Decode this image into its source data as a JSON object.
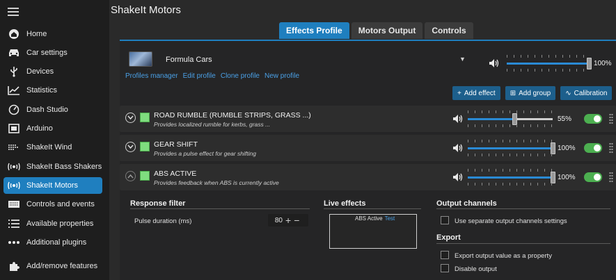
{
  "app": {
    "title": "ShakeIt Motors"
  },
  "sidebar": {
    "items": [
      {
        "label": "Home",
        "icon": "home-icon"
      },
      {
        "label": "Car settings",
        "icon": "car-icon"
      },
      {
        "label": "Devices",
        "icon": "usb-icon"
      },
      {
        "label": "Statistics",
        "icon": "chart-icon"
      },
      {
        "label": "Dash Studio",
        "icon": "gauge-icon"
      },
      {
        "label": "Arduino",
        "icon": "arduino-icon"
      },
      {
        "label": "ShakeIt Wind",
        "icon": "wind-icon"
      },
      {
        "label": "ShakeIt Bass Shakers",
        "icon": "vibration-icon"
      },
      {
        "label": "ShakeIt Motors",
        "icon": "vibration-icon",
        "active": true
      },
      {
        "label": "Controls and events",
        "icon": "keyboard-icon"
      },
      {
        "label": "Available properties",
        "icon": "list-icon"
      },
      {
        "label": "Additional plugins",
        "icon": "dots-icon"
      },
      {
        "label": "Add/remove features",
        "icon": "puzzle-icon"
      }
    ]
  },
  "tabs": [
    {
      "label": "Effects Profile",
      "active": true
    },
    {
      "label": "Motors Output"
    },
    {
      "label": "Controls"
    }
  ],
  "profile": {
    "name": "Formula Cars",
    "links": [
      "Profiles manager",
      "Edit profile",
      "Clone profile",
      "New profile"
    ],
    "master_volume": 100,
    "master_volume_label": "100%"
  },
  "buttons": {
    "add_effect": "Add effect",
    "add_group": "Add group",
    "calibration": "Calibration"
  },
  "effects": [
    {
      "name": "ROAD RUMBLE (RUMBLE STRIPS, GRASS ...)",
      "description": "Provides localized rumble for kerbs, grass ...",
      "volume": 55,
      "volume_label": "55%",
      "enabled": true,
      "expanded": false
    },
    {
      "name": "GEAR SHIFT",
      "description": "Provides a pulse effect for gear shifting",
      "volume": 100,
      "volume_label": "100%",
      "enabled": true,
      "expanded": false
    },
    {
      "name": "ABS ACTIVE",
      "description": "Provides feedback when ABS is currently active",
      "volume": 100,
      "volume_label": "100%",
      "enabled": true,
      "expanded": true
    }
  ],
  "details": {
    "response_filter": {
      "title": "Response filter",
      "pulse_label": "Pulse duration (ms)",
      "pulse_value": "80"
    },
    "live_effects": {
      "title": "Live effects",
      "label": "ABS Active",
      "test": "Test"
    },
    "output_channels": {
      "title": "Output channels",
      "separate_label": "Use separate output channels settings"
    },
    "export": {
      "title": "Export",
      "export_property_label": "Export output value as a property",
      "disable_output_label": "Disable output"
    }
  },
  "colors": {
    "accent": "#1f7fbf",
    "toggle_on": "#4caf50",
    "checkbox_green": "#7fdd7f",
    "link": "#4aa0e6"
  }
}
